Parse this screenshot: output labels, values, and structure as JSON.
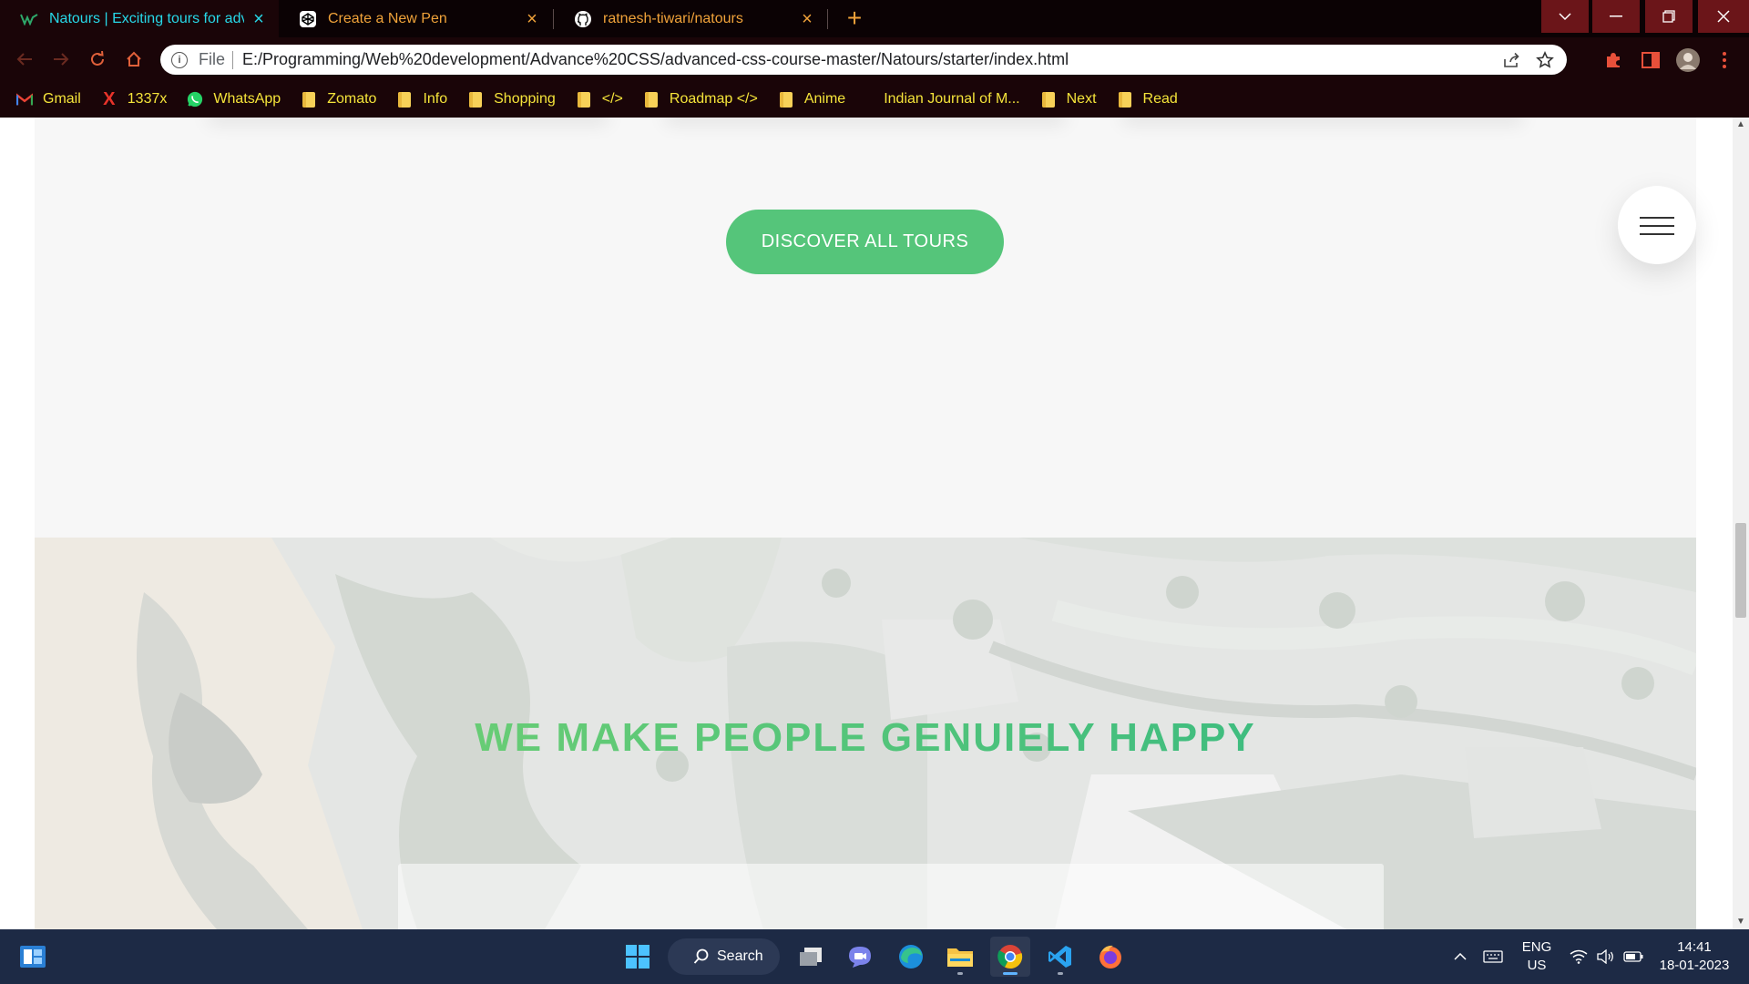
{
  "browser": {
    "tabs": [
      {
        "title": "Natours | Exciting tours for adven",
        "icon": "natours-logo-icon",
        "active": true
      },
      {
        "title": "Create a New Pen",
        "icon": "codepen-icon",
        "active": false
      },
      {
        "title": "ratnesh-tiwari/natours",
        "icon": "github-icon",
        "active": false
      }
    ],
    "tab_close": "×",
    "new_tab": "+",
    "address": {
      "prefix": "File",
      "url": "E:/Programming/Web%20development/Advance%20CSS/advanced-css-course-master/Natours/starter/index.html"
    },
    "bookmarks": [
      {
        "label": "Gmail",
        "icon": "gmail-icon"
      },
      {
        "label": "1337x",
        "icon": "x-icon"
      },
      {
        "label": "WhatsApp",
        "icon": "whatsapp-icon"
      },
      {
        "label": "Zomato",
        "icon": "folder-icon"
      },
      {
        "label": "Info",
        "icon": "folder-icon"
      },
      {
        "label": "Shopping",
        "icon": "folder-icon"
      },
      {
        "label": "</>",
        "icon": "folder-icon"
      },
      {
        "label": "Roadmap </>",
        "icon": "folder-icon"
      },
      {
        "label": "Anime",
        "icon": "folder-icon"
      },
      {
        "label": "Indian Journal of M...",
        "icon": "none"
      },
      {
        "label": "Next",
        "icon": "folder-icon"
      },
      {
        "label": "Read",
        "icon": "folder-icon"
      }
    ]
  },
  "page": {
    "discover_button": "DISCOVER ALL TOURS",
    "stories_heading": "WE MAKE PEOPLE GENUIELY HAPPY"
  },
  "taskbar": {
    "search_label": "Search",
    "language": "ENG",
    "region": "US",
    "time": "14:41",
    "date": "18-01-2023",
    "apps": [
      "task-view",
      "teams",
      "edge",
      "file-explorer",
      "chrome",
      "vscode",
      "firefox"
    ]
  },
  "colors": {
    "accent_green": "#55c57a",
    "heading_gradient_start": "#7ed56f",
    "heading_gradient_end": "#28b485",
    "tab_active_text": "#27d8e8",
    "tab_inactive_text": "#f0a23a",
    "bookmark_text": "#f5e43a"
  }
}
